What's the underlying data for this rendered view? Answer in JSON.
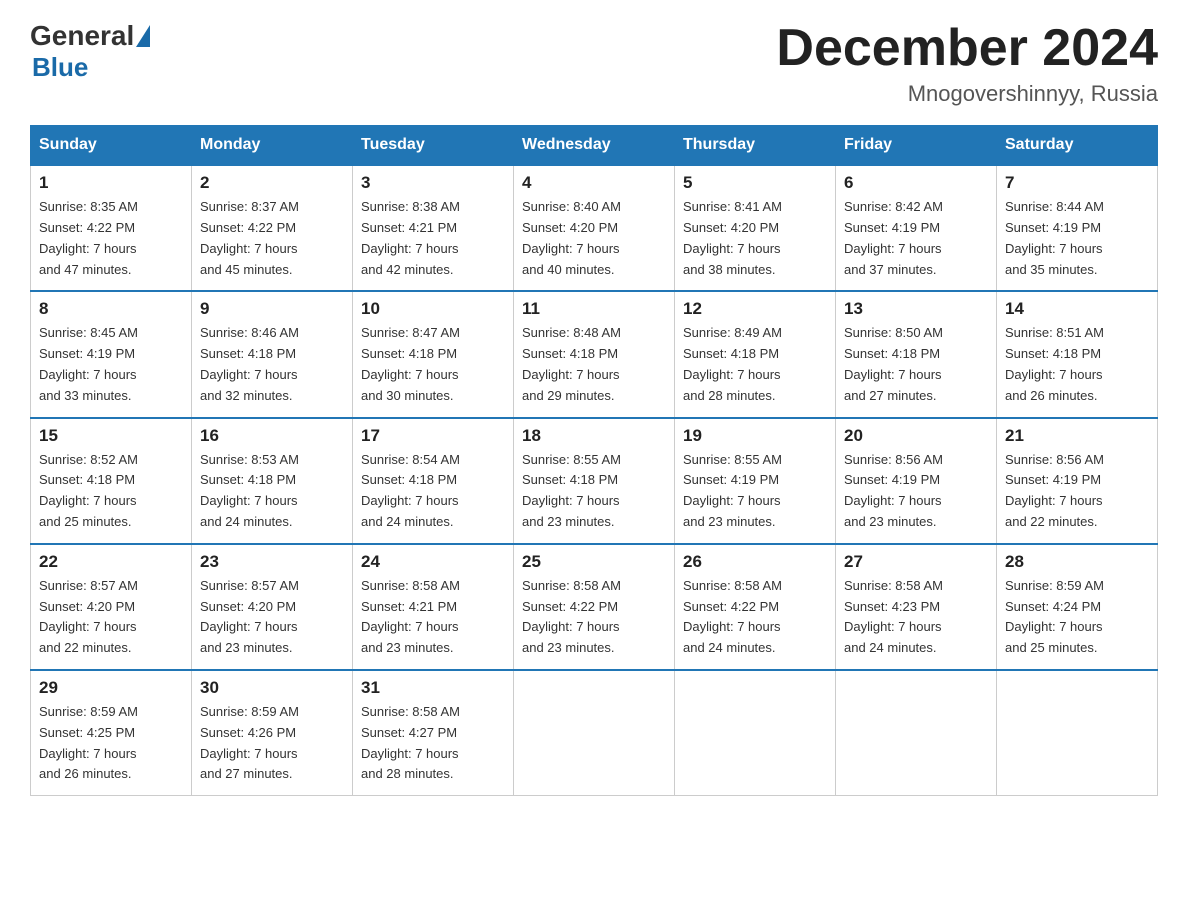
{
  "header": {
    "logo_general": "General",
    "logo_blue": "Blue",
    "month_title": "December 2024",
    "location": "Mnogovershinnyy, Russia"
  },
  "weekdays": [
    "Sunday",
    "Monday",
    "Tuesday",
    "Wednesday",
    "Thursday",
    "Friday",
    "Saturday"
  ],
  "weeks": [
    [
      {
        "day": "1",
        "sunrise": "8:35 AM",
        "sunset": "4:22 PM",
        "daylight": "7 hours and 47 minutes."
      },
      {
        "day": "2",
        "sunrise": "8:37 AM",
        "sunset": "4:22 PM",
        "daylight": "7 hours and 45 minutes."
      },
      {
        "day": "3",
        "sunrise": "8:38 AM",
        "sunset": "4:21 PM",
        "daylight": "7 hours and 42 minutes."
      },
      {
        "day": "4",
        "sunrise": "8:40 AM",
        "sunset": "4:20 PM",
        "daylight": "7 hours and 40 minutes."
      },
      {
        "day": "5",
        "sunrise": "8:41 AM",
        "sunset": "4:20 PM",
        "daylight": "7 hours and 38 minutes."
      },
      {
        "day": "6",
        "sunrise": "8:42 AM",
        "sunset": "4:19 PM",
        "daylight": "7 hours and 37 minutes."
      },
      {
        "day": "7",
        "sunrise": "8:44 AM",
        "sunset": "4:19 PM",
        "daylight": "7 hours and 35 minutes."
      }
    ],
    [
      {
        "day": "8",
        "sunrise": "8:45 AM",
        "sunset": "4:19 PM",
        "daylight": "7 hours and 33 minutes."
      },
      {
        "day": "9",
        "sunrise": "8:46 AM",
        "sunset": "4:18 PM",
        "daylight": "7 hours and 32 minutes."
      },
      {
        "day": "10",
        "sunrise": "8:47 AM",
        "sunset": "4:18 PM",
        "daylight": "7 hours and 30 minutes."
      },
      {
        "day": "11",
        "sunrise": "8:48 AM",
        "sunset": "4:18 PM",
        "daylight": "7 hours and 29 minutes."
      },
      {
        "day": "12",
        "sunrise": "8:49 AM",
        "sunset": "4:18 PM",
        "daylight": "7 hours and 28 minutes."
      },
      {
        "day": "13",
        "sunrise": "8:50 AM",
        "sunset": "4:18 PM",
        "daylight": "7 hours and 27 minutes."
      },
      {
        "day": "14",
        "sunrise": "8:51 AM",
        "sunset": "4:18 PM",
        "daylight": "7 hours and 26 minutes."
      }
    ],
    [
      {
        "day": "15",
        "sunrise": "8:52 AM",
        "sunset": "4:18 PM",
        "daylight": "7 hours and 25 minutes."
      },
      {
        "day": "16",
        "sunrise": "8:53 AM",
        "sunset": "4:18 PM",
        "daylight": "7 hours and 24 minutes."
      },
      {
        "day": "17",
        "sunrise": "8:54 AM",
        "sunset": "4:18 PM",
        "daylight": "7 hours and 24 minutes."
      },
      {
        "day": "18",
        "sunrise": "8:55 AM",
        "sunset": "4:18 PM",
        "daylight": "7 hours and 23 minutes."
      },
      {
        "day": "19",
        "sunrise": "8:55 AM",
        "sunset": "4:19 PM",
        "daylight": "7 hours and 23 minutes."
      },
      {
        "day": "20",
        "sunrise": "8:56 AM",
        "sunset": "4:19 PM",
        "daylight": "7 hours and 23 minutes."
      },
      {
        "day": "21",
        "sunrise": "8:56 AM",
        "sunset": "4:19 PM",
        "daylight": "7 hours and 22 minutes."
      }
    ],
    [
      {
        "day": "22",
        "sunrise": "8:57 AM",
        "sunset": "4:20 PM",
        "daylight": "7 hours and 22 minutes."
      },
      {
        "day": "23",
        "sunrise": "8:57 AM",
        "sunset": "4:20 PM",
        "daylight": "7 hours and 23 minutes."
      },
      {
        "day": "24",
        "sunrise": "8:58 AM",
        "sunset": "4:21 PM",
        "daylight": "7 hours and 23 minutes."
      },
      {
        "day": "25",
        "sunrise": "8:58 AM",
        "sunset": "4:22 PM",
        "daylight": "7 hours and 23 minutes."
      },
      {
        "day": "26",
        "sunrise": "8:58 AM",
        "sunset": "4:22 PM",
        "daylight": "7 hours and 24 minutes."
      },
      {
        "day": "27",
        "sunrise": "8:58 AM",
        "sunset": "4:23 PM",
        "daylight": "7 hours and 24 minutes."
      },
      {
        "day": "28",
        "sunrise": "8:59 AM",
        "sunset": "4:24 PM",
        "daylight": "7 hours and 25 minutes."
      }
    ],
    [
      {
        "day": "29",
        "sunrise": "8:59 AM",
        "sunset": "4:25 PM",
        "daylight": "7 hours and 26 minutes."
      },
      {
        "day": "30",
        "sunrise": "8:59 AM",
        "sunset": "4:26 PM",
        "daylight": "7 hours and 27 minutes."
      },
      {
        "day": "31",
        "sunrise": "8:58 AM",
        "sunset": "4:27 PM",
        "daylight": "7 hours and 28 minutes."
      },
      null,
      null,
      null,
      null
    ]
  ],
  "labels": {
    "sunrise": "Sunrise:",
    "sunset": "Sunset:",
    "daylight": "Daylight:"
  }
}
